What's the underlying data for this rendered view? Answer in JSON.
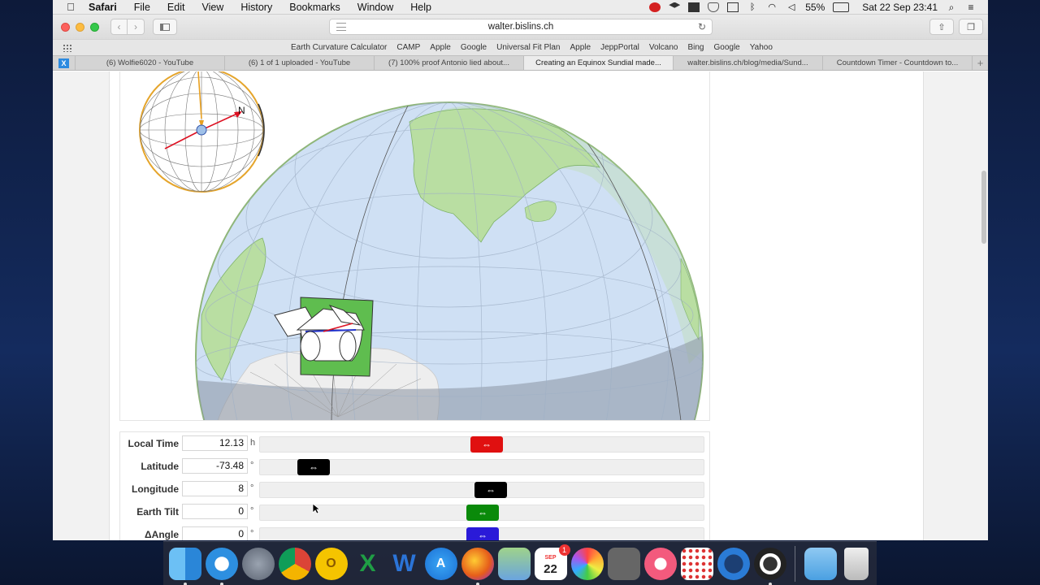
{
  "menubar": {
    "app": "Safari",
    "items": [
      "File",
      "Edit",
      "View",
      "History",
      "Bookmarks",
      "Window",
      "Help"
    ],
    "battery": "55%",
    "clock": "Sat 22 Sep  23:41"
  },
  "toolbar": {
    "url": "walter.bislins.ch"
  },
  "favorites": [
    "Earth Curvature Calculator",
    "CAMP",
    "Apple",
    "Google",
    "Universal Fit Plan",
    "Apple",
    "JeppPortal",
    "Volcano",
    "Bing",
    "Google",
    "Yahoo"
  ],
  "tabs": [
    {
      "label": "(6) Wolfie6020 - YouTube",
      "active": false
    },
    {
      "label": "(6) 1 of 1 uploaded - YouTube",
      "active": false
    },
    {
      "label": "(7) 100% proof Antonio lied about...",
      "active": false
    },
    {
      "label": "Creating an Equinox Sundial made...",
      "active": true
    },
    {
      "label": "walter.bislins.ch/blog/media/Sund...",
      "active": false
    },
    {
      "label": "Countdown Timer - Countdown to...",
      "active": false
    }
  ],
  "pinned_tab": "X",
  "globe": {
    "north_label": "N"
  },
  "controls": [
    {
      "label": "Local Time",
      "value": "12.13",
      "unit": "h",
      "handle_color": "#e01010",
      "position": 0.51
    },
    {
      "label": "Latitude",
      "value": "-73.48",
      "unit": "°",
      "handle_color": "#000000",
      "position": 0.09
    },
    {
      "label": "Longitude",
      "value": "8",
      "unit": "°",
      "handle_color": "#000000",
      "position": 0.52
    },
    {
      "label": "Earth Tilt",
      "value": "0",
      "unit": "°",
      "handle_color": "#0a8a0a",
      "position": 0.5
    },
    {
      "label": "ΔAngle",
      "value": "0",
      "unit": "°",
      "handle_color": "#2a1ad8",
      "position": 0.5
    }
  ],
  "handle_glyph": "⇔",
  "dock": {
    "calendar_month": "SEP",
    "calendar_day": "22",
    "calendar_badge": "1"
  }
}
